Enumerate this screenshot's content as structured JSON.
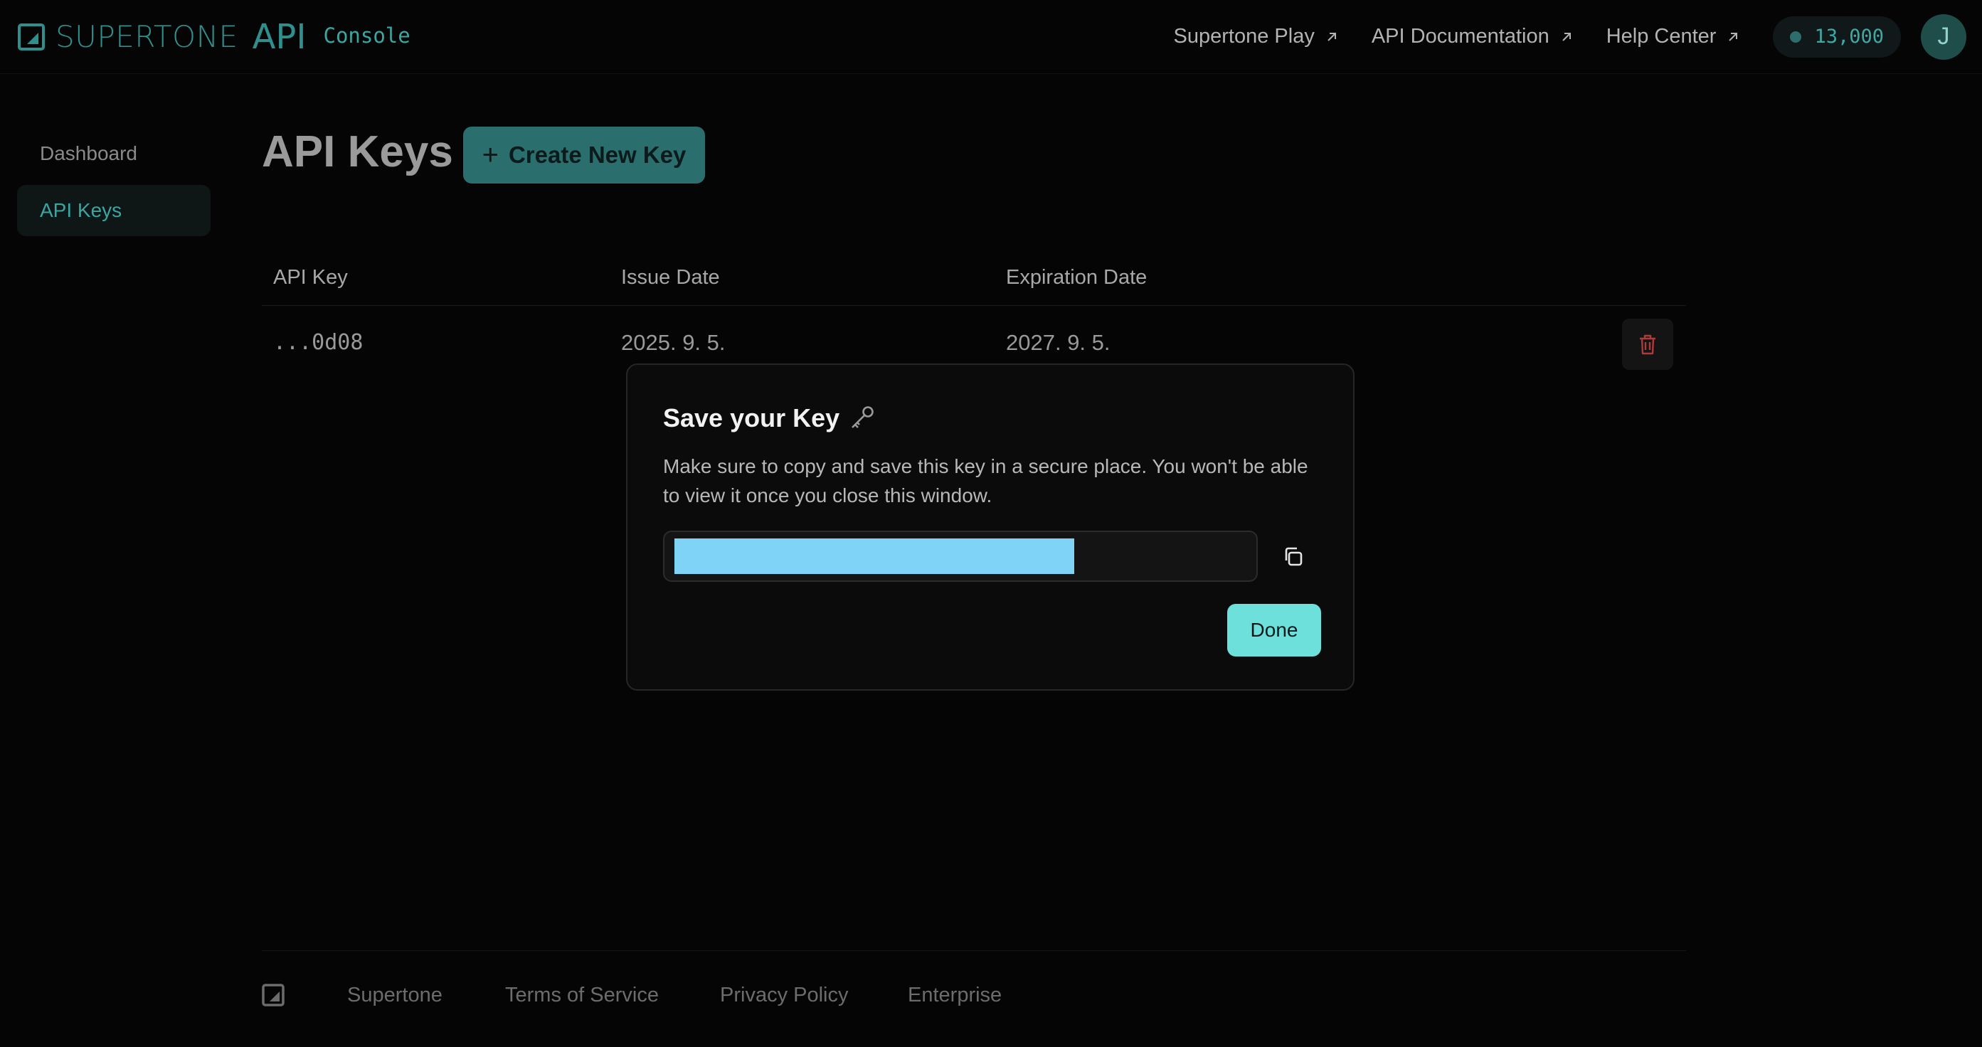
{
  "header": {
    "brand_name": "SUPERTONE",
    "brand_api": "API",
    "brand_console": "Console",
    "links": [
      {
        "label": "Supertone Play",
        "icon": "arrow-up-right-icon"
      },
      {
        "label": "API Documentation",
        "icon": "arrow-up-right-icon"
      },
      {
        "label": "Help Center",
        "icon": "arrow-up-right-icon"
      }
    ],
    "credits": "13,000",
    "avatar_initial": "J"
  },
  "sidebar": {
    "items": [
      {
        "label": "Dashboard",
        "active": false
      },
      {
        "label": "API Keys",
        "active": true
      }
    ]
  },
  "main": {
    "title": "API Keys",
    "create_button": {
      "plus": "+",
      "label": "Create New Key"
    },
    "table": {
      "headers": [
        "API Key",
        "Issue Date",
        "Expiration Date"
      ],
      "rows": [
        {
          "key": "...0d08",
          "issue_date": "2025. 9. 5.",
          "expiration_date": "2027. 9. 5."
        }
      ]
    }
  },
  "modal": {
    "title": "Save your Key",
    "title_icon": "key-icon",
    "description": "Make sure to copy and save this key in a secure place. You won't be able to view it once you close this window.",
    "key_value": "",
    "copy_icon": "copy-icon",
    "done_label": "Done"
  },
  "footer": {
    "links": [
      "Supertone",
      "Terms of Service",
      "Privacy Policy",
      "Enterprise"
    ]
  },
  "colors": {
    "background": "#050505",
    "accent": "#3aa6a2",
    "primary_button": "#2a6f6d",
    "done_button": "#6ee0dc",
    "key_highlight": "#7fd3f7",
    "danger": "#b03a3a"
  }
}
